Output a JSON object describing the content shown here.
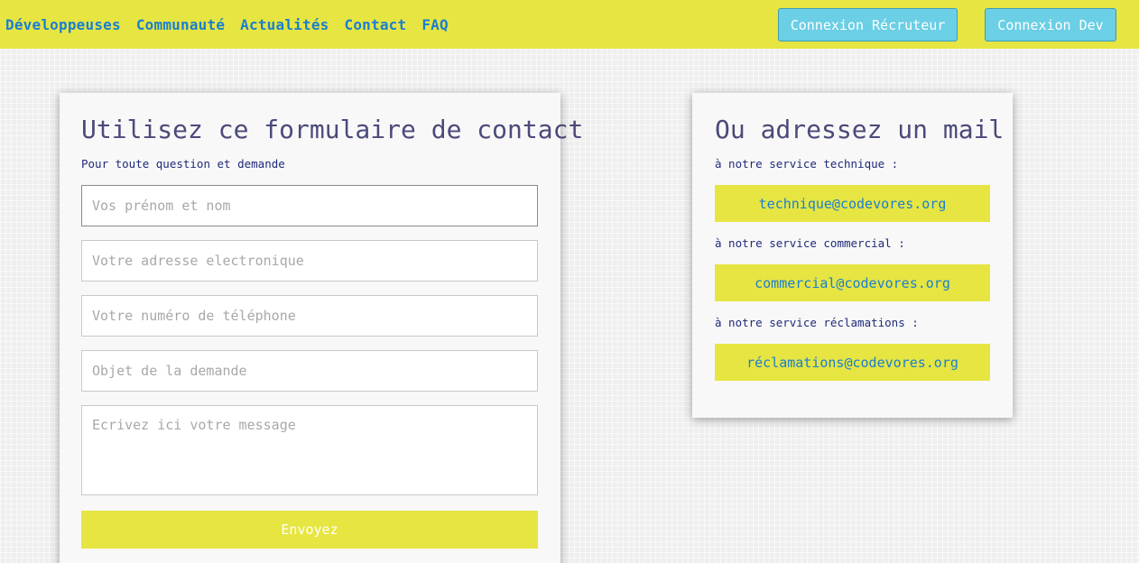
{
  "nav": {
    "links": [
      "Développeuses",
      "Communauté",
      "Actualités",
      "Contact",
      "FAQ"
    ],
    "login_recruiter": "Connexion Récruteur",
    "login_dev": "Connexion Dev"
  },
  "form": {
    "title": "Utilisez ce formulaire de contact",
    "subtitle": "Pour toute question et demande",
    "name_placeholder": "Vos prénom et nom",
    "email_placeholder": "Votre adresse electronique",
    "phone_placeholder": "Votre numéro de téléphone",
    "subject_placeholder": "Objet de la demande",
    "message_placeholder": "Ecrivez ici votre message",
    "submit_label": "Envoyez"
  },
  "mail": {
    "title": "Ou adressez un mail",
    "services": [
      {
        "label": "à notre service technique :",
        "email": "technique@codevores.org"
      },
      {
        "label": "à notre service commercial :",
        "email": "commercial@codevores.org"
      },
      {
        "label": "à notre service réclamations :",
        "email": "réclamations@codevores.org"
      }
    ]
  },
  "colors": {
    "accent_yellow": "#e6e542",
    "link_blue": "#1a7fd1",
    "button_cyan": "#6bcfe5",
    "title_purple": "#4b4a7a",
    "label_navy": "#1e2a7a"
  }
}
